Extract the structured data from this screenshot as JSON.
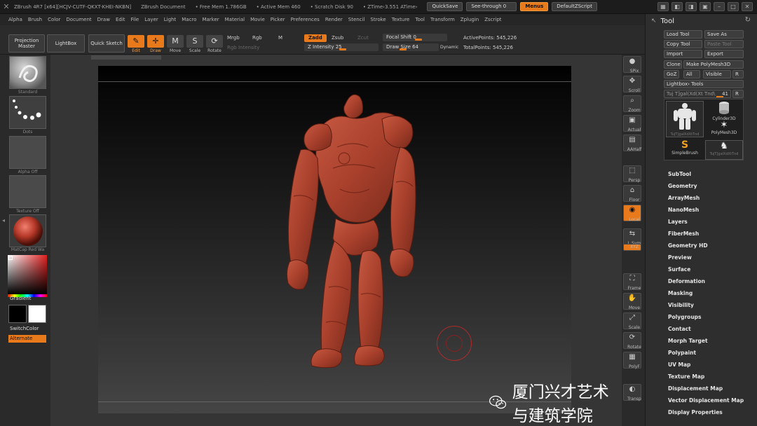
{
  "titlebar": {
    "app": "ZBrush 4R7 [x64][HCJV-CUTF-QKXT-KHEI-NKBN]",
    "document": "ZBrush Document",
    "free_mem": "• Free Mem 1.786GB",
    "active_mem": "• Active Mem 460",
    "scratch_disk": "• Scratch Disk 90",
    "ztime": "• ZTime›3.551 ATime›",
    "quicksave": "QuickSave",
    "see_through": "See-through  0",
    "menus": "Menus",
    "default_script": "DefaultZScript"
  },
  "menubar": [
    "Alpha",
    "Brush",
    "Color",
    "Document",
    "Draw",
    "Edit",
    "File",
    "Layer",
    "Light",
    "Macro",
    "Marker",
    "Material",
    "Movie",
    "Picker",
    "Preferences",
    "Render",
    "Stencil",
    "Stroke",
    "Texture",
    "Tool",
    "Transform",
    "Zplugin",
    "Zscript"
  ],
  "shelf": {
    "projection_master": "Projection Master",
    "lightbox": "LightBox",
    "quick_sketch": "Quick Sketch",
    "modes": [
      {
        "label": "Edit",
        "glyph": "✎"
      },
      {
        "label": "Draw",
        "glyph": "✛"
      },
      {
        "label": "Move",
        "glyph": "M"
      },
      {
        "label": "Scale",
        "glyph": "S"
      },
      {
        "label": "Rotate",
        "glyph": "⟳"
      }
    ],
    "mrgb": "Mrgb",
    "rgb": "Rgb",
    "m": "M",
    "rgb_intensity": "Rgb Intensity",
    "zadd": "Zadd",
    "zsub": "Zsub",
    "zcut": "Zcut",
    "z_intensity": "Z Intensity 25",
    "focal_shift": "Focal Shift 0",
    "draw_size": "Draw Size 64",
    "dynamic": "Dynamic",
    "active_points": "ActivePoints: 545,226",
    "total_points": "TotalPoints: 545,226"
  },
  "left": {
    "brush": "Standard",
    "stroke": "Dots",
    "alpha": "Alpha  Off",
    "texture": "Texture  Off",
    "material": "MatCap Red Wa",
    "gradient": "Gradient",
    "switch_color": "SwitchColor",
    "alternate": "Alternate"
  },
  "right_toolbar": [
    "SPix",
    "Scroll",
    "Zoom",
    "Actual",
    "AAHalf",
    "Persp",
    "Floor",
    "Local",
    "L.Sym",
    "XYZ",
    "Frame",
    "Move",
    "Scale",
    "Rotate",
    "PolyF",
    "Transp"
  ],
  "tool_panel": {
    "title": "Tool",
    "load_tool": "Load Tool",
    "save_as": "Save As",
    "copy_tool": "Copy Tool",
    "paste_tool": "Paste Tool",
    "import": "Import",
    "export": "Export",
    "clone": "Clone",
    "make_polymesh": "Make PolyMesh3D",
    "goz": "GoZ",
    "all": "All",
    "visible": "Visible",
    "r": "R",
    "lightbox_tools": "Lightbox› Tools",
    "current_tool": "Tuj T]gal(Xd(Xt Tnd\\",
    "current_tool_value": "41",
    "thumbs": [
      "TujT]galXdXtTnd",
      "Cylinder3D",
      "PolyMesh3D",
      "SimpleBrush",
      "TujT]galXdXtTnd"
    ],
    "sections": [
      "SubTool",
      "Geometry",
      "ArrayMesh",
      "NanoMesh",
      "Layers",
      "FiberMesh",
      "Geometry HD",
      "Preview",
      "Surface",
      "Deformation",
      "Masking",
      "Visibility",
      "Polygroups",
      "Contact",
      "Morph Target",
      "Polypaint",
      "UV Map",
      "Texture Map",
      "Displacement Map",
      "Vector Displacement Map",
      "Display Properties"
    ]
  },
  "watermark": "厦门兴才艺术与建筑学院",
  "colors": {
    "accent": "#e87a1c",
    "model": "#b8452f"
  }
}
